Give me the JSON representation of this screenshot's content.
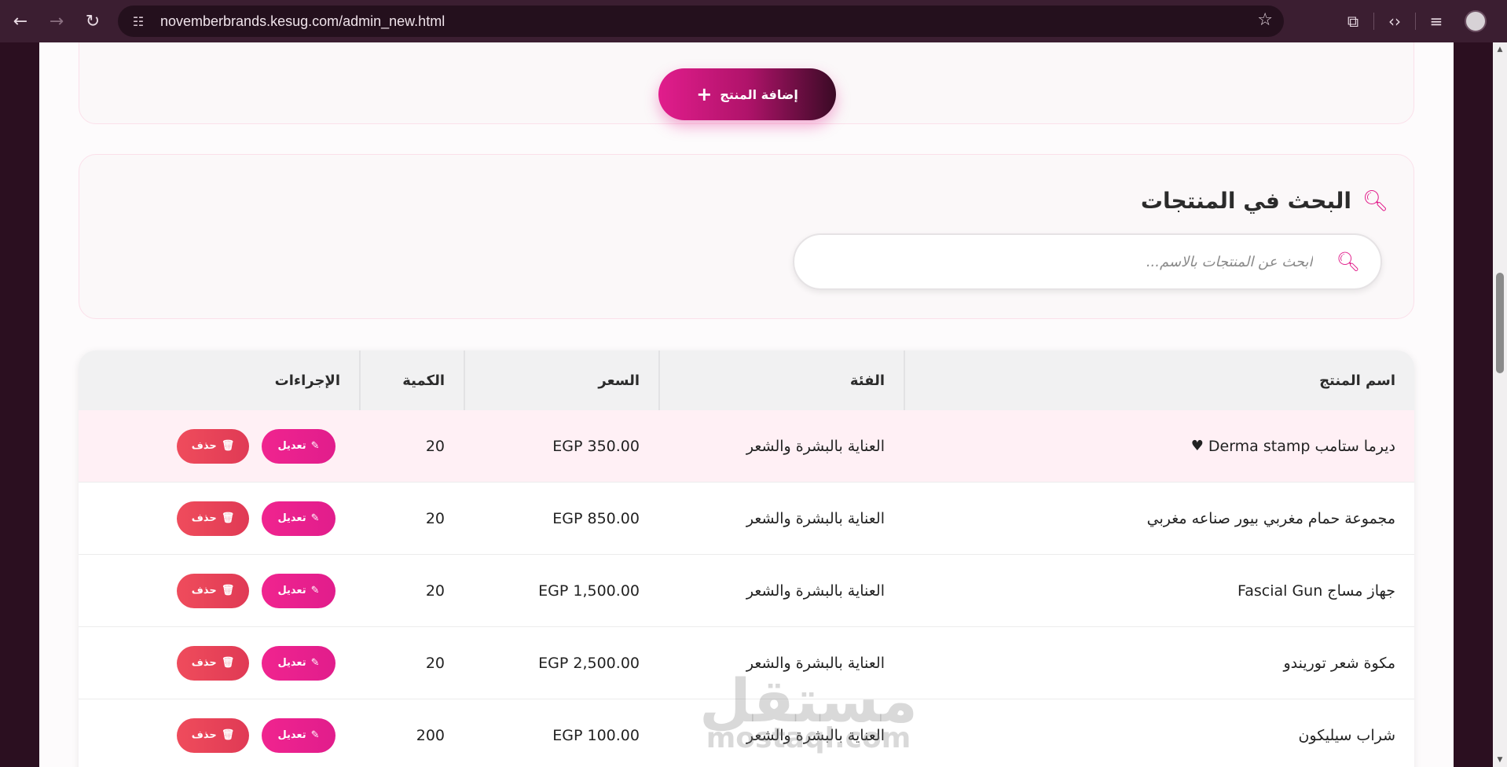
{
  "browser": {
    "url": "novemberbrands.kesug.com/admin_new.html"
  },
  "add_product": {
    "label": "إضافة المنتج"
  },
  "search": {
    "title": "البحث في المنتجات",
    "placeholder": "ابحث عن المنتجات بالاسم..."
  },
  "table": {
    "headers": {
      "name": "اسم المنتج",
      "category": "الفئة",
      "price": "السعر",
      "quantity": "الكمية",
      "actions": "الإجراءات"
    },
    "edit_label": "تعديل",
    "delete_label": "حذف",
    "rows": [
      {
        "name": "ديرما ستامب Derma stamp",
        "category": "العناية بالبشرة والشعر",
        "price": "EGP 350.00",
        "quantity": "20"
      },
      {
        "name": "مجموعة حمام مغربي بيور صناعه مغربي",
        "category": "العناية بالبشرة والشعر",
        "price": "EGP 850.00",
        "quantity": "20"
      },
      {
        "name": "جهاز مساج Fascial Gun",
        "category": "العناية بالبشرة والشعر",
        "price": "EGP 1,500.00",
        "quantity": "20"
      },
      {
        "name": "مكوة شعر توريندو",
        "category": "العناية بالبشرة والشعر",
        "price": "EGP 2,500.00",
        "quantity": "20"
      },
      {
        "name": "شراب سيليكون",
        "category": "العناية بالبشرة والشعر",
        "price": "EGP 100.00",
        "quantity": "200"
      }
    ]
  },
  "watermark": {
    "arabic": "مستقل",
    "latin": "mostaql.com"
  },
  "colors": {
    "accent": "#e21f8c",
    "delete": "#e03a55",
    "highlight_row": "#fff0f5"
  }
}
